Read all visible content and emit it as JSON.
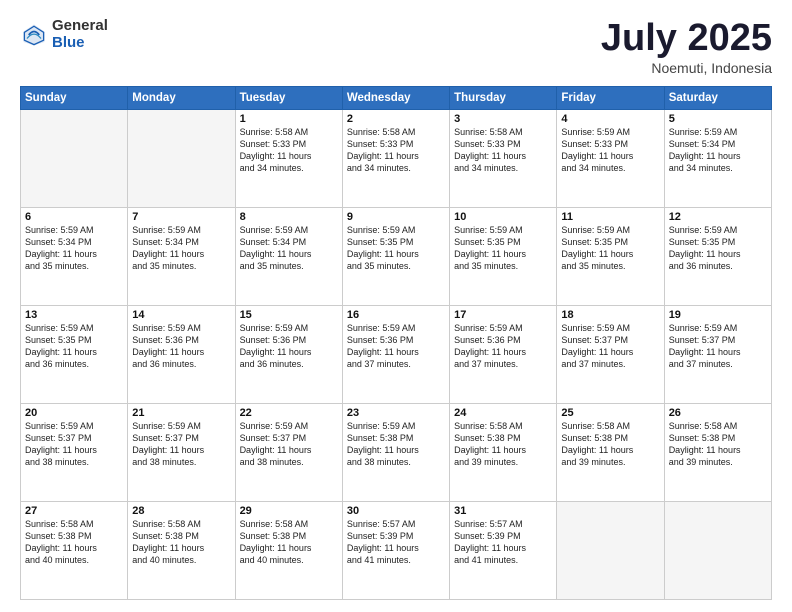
{
  "logo": {
    "general": "General",
    "blue": "Blue"
  },
  "title": "July 2025",
  "location": "Noemuti, Indonesia",
  "days_header": [
    "Sunday",
    "Monday",
    "Tuesday",
    "Wednesday",
    "Thursday",
    "Friday",
    "Saturday"
  ],
  "weeks": [
    [
      {
        "day": "",
        "info": ""
      },
      {
        "day": "",
        "info": ""
      },
      {
        "day": "1",
        "info": "Sunrise: 5:58 AM\nSunset: 5:33 PM\nDaylight: 11 hours\nand 34 minutes."
      },
      {
        "day": "2",
        "info": "Sunrise: 5:58 AM\nSunset: 5:33 PM\nDaylight: 11 hours\nand 34 minutes."
      },
      {
        "day": "3",
        "info": "Sunrise: 5:58 AM\nSunset: 5:33 PM\nDaylight: 11 hours\nand 34 minutes."
      },
      {
        "day": "4",
        "info": "Sunrise: 5:59 AM\nSunset: 5:33 PM\nDaylight: 11 hours\nand 34 minutes."
      },
      {
        "day": "5",
        "info": "Sunrise: 5:59 AM\nSunset: 5:34 PM\nDaylight: 11 hours\nand 34 minutes."
      }
    ],
    [
      {
        "day": "6",
        "info": "Sunrise: 5:59 AM\nSunset: 5:34 PM\nDaylight: 11 hours\nand 35 minutes."
      },
      {
        "day": "7",
        "info": "Sunrise: 5:59 AM\nSunset: 5:34 PM\nDaylight: 11 hours\nand 35 minutes."
      },
      {
        "day": "8",
        "info": "Sunrise: 5:59 AM\nSunset: 5:34 PM\nDaylight: 11 hours\nand 35 minutes."
      },
      {
        "day": "9",
        "info": "Sunrise: 5:59 AM\nSunset: 5:35 PM\nDaylight: 11 hours\nand 35 minutes."
      },
      {
        "day": "10",
        "info": "Sunrise: 5:59 AM\nSunset: 5:35 PM\nDaylight: 11 hours\nand 35 minutes."
      },
      {
        "day": "11",
        "info": "Sunrise: 5:59 AM\nSunset: 5:35 PM\nDaylight: 11 hours\nand 35 minutes."
      },
      {
        "day": "12",
        "info": "Sunrise: 5:59 AM\nSunset: 5:35 PM\nDaylight: 11 hours\nand 36 minutes."
      }
    ],
    [
      {
        "day": "13",
        "info": "Sunrise: 5:59 AM\nSunset: 5:35 PM\nDaylight: 11 hours\nand 36 minutes."
      },
      {
        "day": "14",
        "info": "Sunrise: 5:59 AM\nSunset: 5:36 PM\nDaylight: 11 hours\nand 36 minutes."
      },
      {
        "day": "15",
        "info": "Sunrise: 5:59 AM\nSunset: 5:36 PM\nDaylight: 11 hours\nand 36 minutes."
      },
      {
        "day": "16",
        "info": "Sunrise: 5:59 AM\nSunset: 5:36 PM\nDaylight: 11 hours\nand 37 minutes."
      },
      {
        "day": "17",
        "info": "Sunrise: 5:59 AM\nSunset: 5:36 PM\nDaylight: 11 hours\nand 37 minutes."
      },
      {
        "day": "18",
        "info": "Sunrise: 5:59 AM\nSunset: 5:37 PM\nDaylight: 11 hours\nand 37 minutes."
      },
      {
        "day": "19",
        "info": "Sunrise: 5:59 AM\nSunset: 5:37 PM\nDaylight: 11 hours\nand 37 minutes."
      }
    ],
    [
      {
        "day": "20",
        "info": "Sunrise: 5:59 AM\nSunset: 5:37 PM\nDaylight: 11 hours\nand 38 minutes."
      },
      {
        "day": "21",
        "info": "Sunrise: 5:59 AM\nSunset: 5:37 PM\nDaylight: 11 hours\nand 38 minutes."
      },
      {
        "day": "22",
        "info": "Sunrise: 5:59 AM\nSunset: 5:37 PM\nDaylight: 11 hours\nand 38 minutes."
      },
      {
        "day": "23",
        "info": "Sunrise: 5:59 AM\nSunset: 5:38 PM\nDaylight: 11 hours\nand 38 minutes."
      },
      {
        "day": "24",
        "info": "Sunrise: 5:58 AM\nSunset: 5:38 PM\nDaylight: 11 hours\nand 39 minutes."
      },
      {
        "day": "25",
        "info": "Sunrise: 5:58 AM\nSunset: 5:38 PM\nDaylight: 11 hours\nand 39 minutes."
      },
      {
        "day": "26",
        "info": "Sunrise: 5:58 AM\nSunset: 5:38 PM\nDaylight: 11 hours\nand 39 minutes."
      }
    ],
    [
      {
        "day": "27",
        "info": "Sunrise: 5:58 AM\nSunset: 5:38 PM\nDaylight: 11 hours\nand 40 minutes."
      },
      {
        "day": "28",
        "info": "Sunrise: 5:58 AM\nSunset: 5:38 PM\nDaylight: 11 hours\nand 40 minutes."
      },
      {
        "day": "29",
        "info": "Sunrise: 5:58 AM\nSunset: 5:38 PM\nDaylight: 11 hours\nand 40 minutes."
      },
      {
        "day": "30",
        "info": "Sunrise: 5:57 AM\nSunset: 5:39 PM\nDaylight: 11 hours\nand 41 minutes."
      },
      {
        "day": "31",
        "info": "Sunrise: 5:57 AM\nSunset: 5:39 PM\nDaylight: 11 hours\nand 41 minutes."
      },
      {
        "day": "",
        "info": ""
      },
      {
        "day": "",
        "info": ""
      }
    ]
  ]
}
